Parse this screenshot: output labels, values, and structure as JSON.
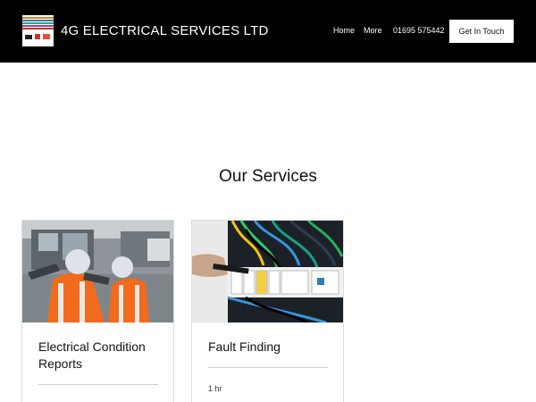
{
  "header": {
    "site_title": "4G ELECTRICAL SERVICES LTD",
    "logo_icon": "company-logo-icon",
    "nav": {
      "home": "Home",
      "more": "More",
      "phone": "01695 575442"
    },
    "cta_label": "Get In Touch"
  },
  "services": {
    "title": "Our Services",
    "items": [
      {
        "name": "Electrical Condition Reports",
        "image_icon": "technicians-at-panel-photo"
      },
      {
        "name": "Fault Finding",
        "duration": "1 hr",
        "image_icon": "fuse-board-wiring-photo"
      }
    ]
  },
  "colors": {
    "header_bg": "#000000",
    "page_bg": "#ffffff",
    "border": "#dcdcdc"
  }
}
